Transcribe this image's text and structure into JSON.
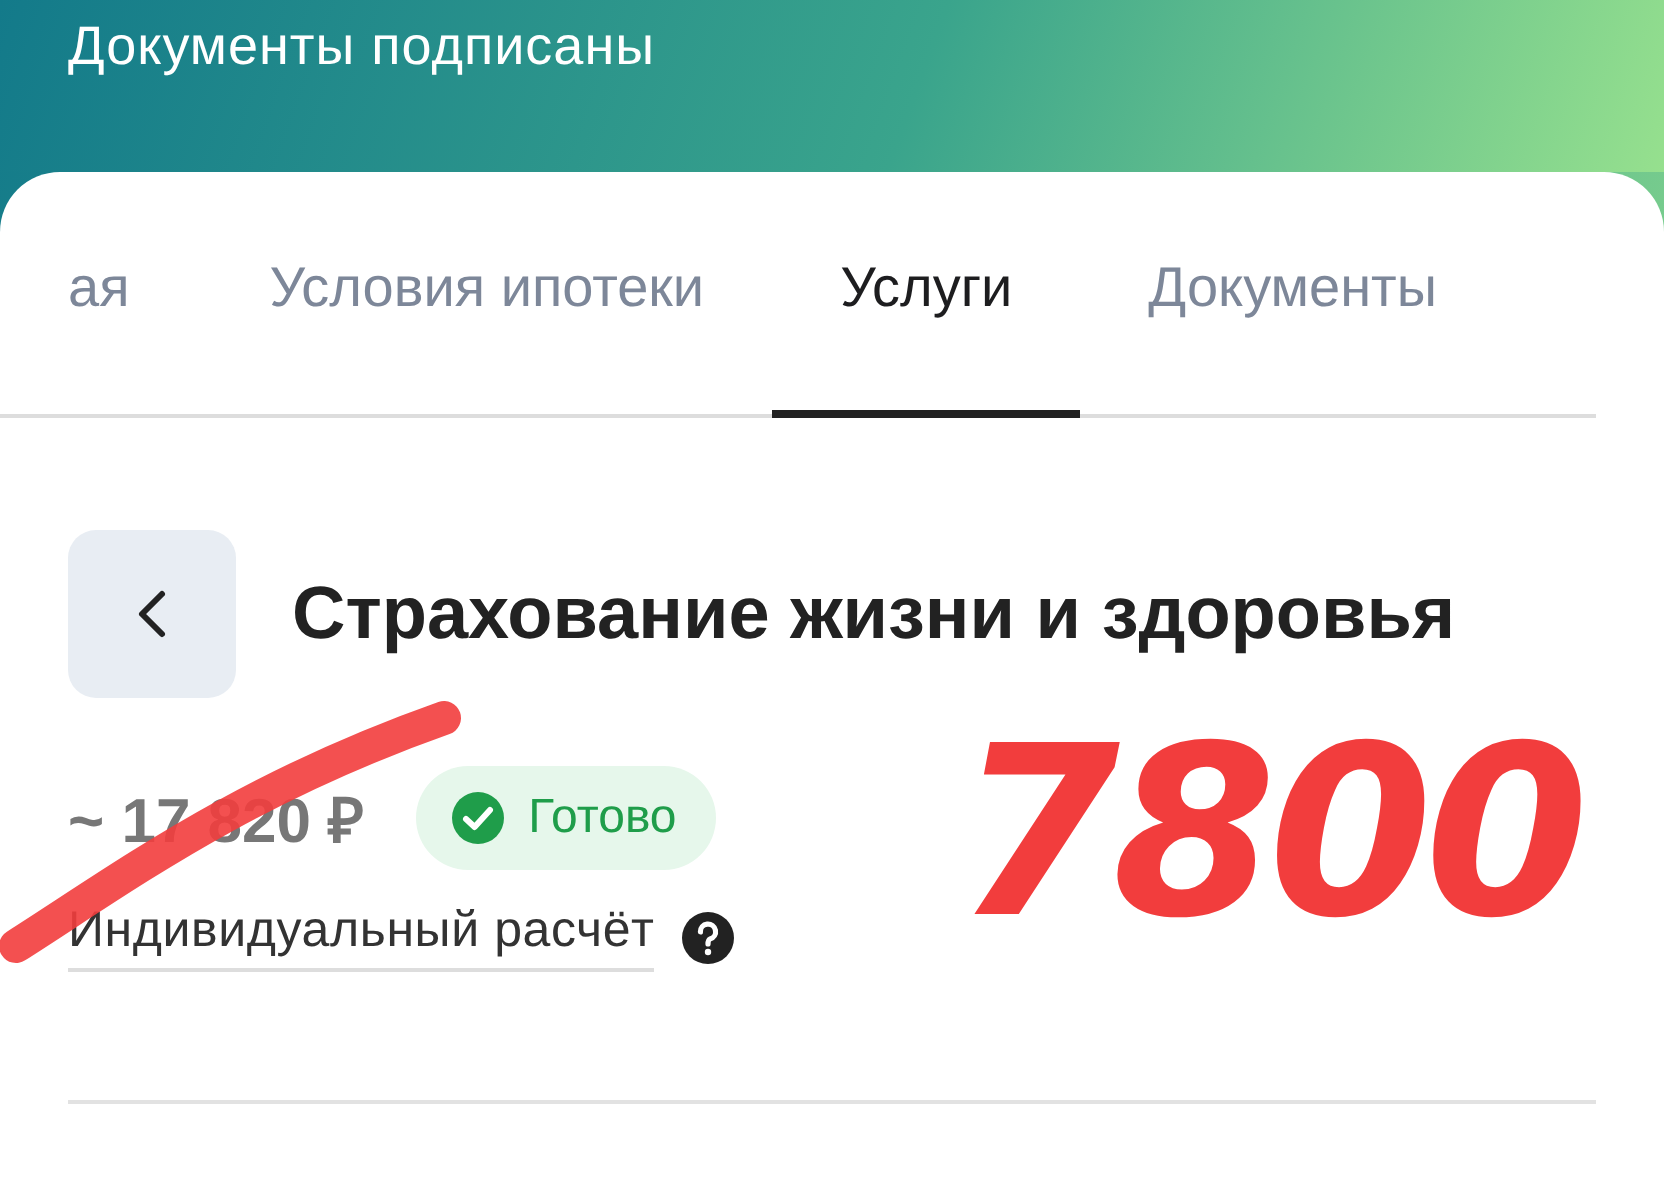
{
  "header": {
    "title": "Документы подписаны"
  },
  "tabs": [
    {
      "label": "ая",
      "selected": false
    },
    {
      "label": "Условия ипотеки",
      "selected": false
    },
    {
      "label": "Услуги",
      "selected": true
    },
    {
      "label": "Документы",
      "selected": false
    }
  ],
  "service": {
    "title": "Страхование жизни и здоровья",
    "price": "~ 17 820 ₽",
    "status": "Готово",
    "calculation_link": "Индивидуальный расчёт"
  },
  "annotation": {
    "price_struck_out": true,
    "handwritten_note": "7800"
  }
}
